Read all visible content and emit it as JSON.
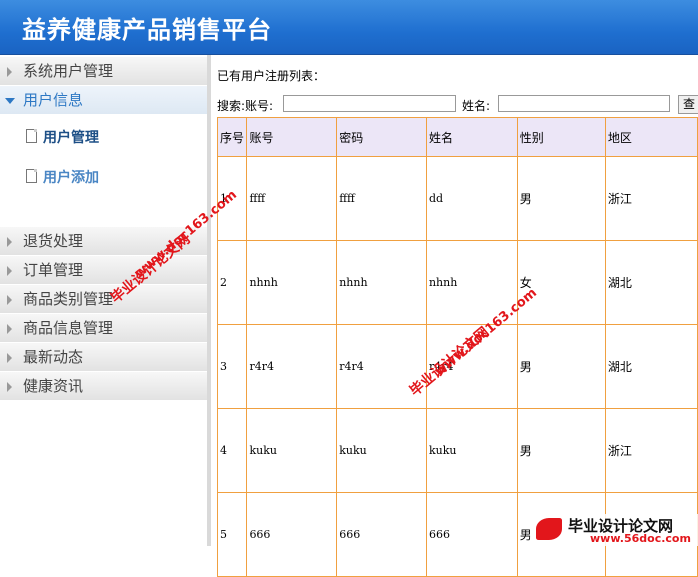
{
  "header": {
    "title": "益养健康产品销售平台"
  },
  "sidebar": {
    "items": [
      {
        "label": "系统用户管理",
        "open": false
      },
      {
        "label": "用户信息",
        "open": true
      },
      {
        "label": "退货处理",
        "open": false
      },
      {
        "label": "订单管理",
        "open": false
      },
      {
        "label": "商品类别管理",
        "open": false
      },
      {
        "label": "商品信息管理",
        "open": false
      },
      {
        "label": "最新动态",
        "open": false
      },
      {
        "label": "健康资讯",
        "open": false
      }
    ],
    "subitems": [
      {
        "label": "用户管理"
      },
      {
        "label": "用户添加"
      }
    ]
  },
  "main": {
    "caption": "已有用户注册列表：",
    "search": {
      "account_label": "搜索:账号:",
      "account_value": "",
      "name_label": "姓名:",
      "name_value": "",
      "button_label": "查"
    },
    "table": {
      "headers": [
        "序号",
        "账号",
        "密码",
        "姓名",
        "性别",
        "地区"
      ],
      "rows": [
        [
          "1",
          "ffff",
          "ffff",
          "dd",
          "男",
          "浙江"
        ],
        [
          "2",
          "nhnh",
          "nhnh",
          "nhnh",
          "女",
          "湖北"
        ],
        [
          "3",
          "r4r4",
          "r4r4",
          "r4r4",
          "男",
          "湖北"
        ],
        [
          "4",
          "kuku",
          "kuku",
          "kuku",
          "男",
          "浙江"
        ],
        [
          "5",
          "666",
          "666",
          "666",
          "男",
          ""
        ]
      ]
    }
  },
  "watermark": {
    "line1": "毕业设计论文网",
    "line2": "www.doc163.com",
    "logo_title": "毕业设计论文网",
    "logo_url": "www.56doc.com"
  }
}
